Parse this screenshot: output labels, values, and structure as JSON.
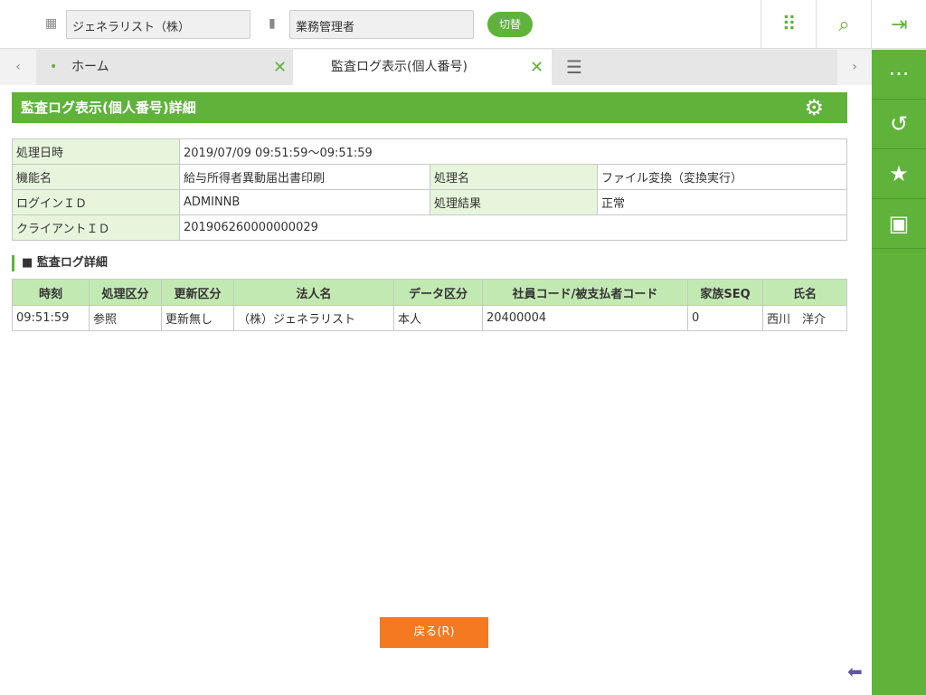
{
  "header": {
    "company": "ジェネラリスト（株）",
    "role": "業務管理者",
    "switch_label": "切替"
  },
  "tabs": [
    {
      "label": "ホーム"
    },
    {
      "label": "監査ログ表示(個人番号)"
    }
  ],
  "page_title": "監査ログ表示(個人番号)詳細",
  "summary": {
    "date_label": "処理日時",
    "date_value": "2019/07/09 09:51:59～09:51:59",
    "func_label": "機能名",
    "func_value": "給与所得者異動届出書印刷",
    "proc_label": "処理名",
    "proc_value": "ファイル変換（変換実行）",
    "login_label": "ログインＩＤ",
    "login_value": "ADMINNB",
    "result_label": "処理結果",
    "result_value": "正常",
    "client_label": "クライアントＩＤ",
    "client_value": "201906260000000029"
  },
  "detail": {
    "section_title": "監査ログ詳細",
    "headers": [
      "時刻",
      "処理区分",
      "更新区分",
      "法人名",
      "データ区分",
      "社員コード/被支払者コード",
      "家族SEQ",
      "氏名"
    ],
    "rows": [
      [
        "09:51:59",
        "参照",
        "更新無し",
        "（株）ジェネラリスト",
        "本人",
        "20400004",
        "0",
        "西川　洋介"
      ]
    ]
  },
  "back_label": "戻る(R)"
}
